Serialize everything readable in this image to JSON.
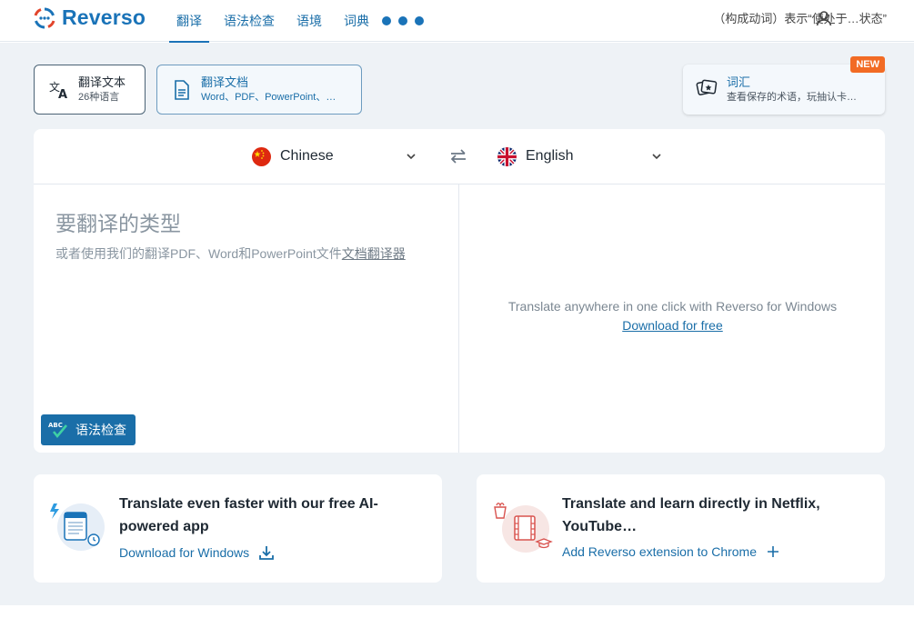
{
  "header": {
    "logo": "Reverso",
    "nav": [
      "翻译",
      "语法检查",
      "语境",
      "词典"
    ],
    "right_text": "（构成动词）表示“使处于…状态”"
  },
  "modes": {
    "text": {
      "title": "翻译文本",
      "subtitle": "26种语言"
    },
    "document": {
      "title": "翻译文档",
      "subtitle": "Word、PDF、PowerPoint、…"
    },
    "vocab": {
      "title": "词汇",
      "subtitle": "查看保存的术语，玩抽认卡…",
      "badge": "NEW"
    }
  },
  "translator": {
    "source_lang": "Chinese",
    "target_lang": "English",
    "placeholder": "要翻译的类型",
    "hint_prefix": "或者使用我们的翻译PDF、Word和PowerPoint文件",
    "hint_link": "文档翻译器",
    "grammar_button": "语法检查",
    "grammar_abc": "ABC",
    "promo_text": "Translate anywhere in one click with Reverso for Windows",
    "promo_link": "Download for free"
  },
  "cards": {
    "app": {
      "title": "Translate even faster with our free AI-powered app",
      "cta": "Download for Windows"
    },
    "extension": {
      "title": "Translate and learn directly in Netflix, YouTube…",
      "cta": "Add Reverso extension to Chrome"
    }
  },
  "colors": {
    "brand": "#1a73b8",
    "badge": "#f26b24",
    "background": "#eef2f6"
  }
}
